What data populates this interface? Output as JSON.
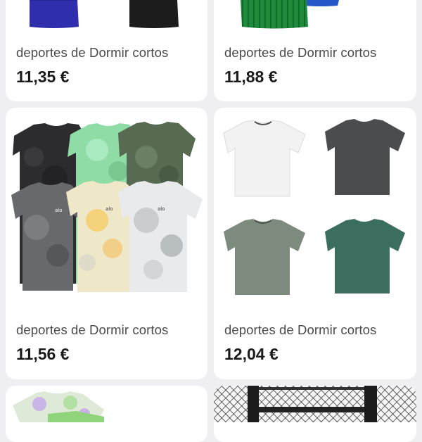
{
  "products": [
    {
      "title": "deportes de Dormir cortos",
      "price": "11,35 €"
    },
    {
      "title": "deportes de Dormir cortos",
      "price": "11,88 €"
    },
    {
      "title": "deportes de Dormir cortos",
      "price": "11,56 €"
    },
    {
      "title": "deportes de Dormir cortos",
      "price": "12,04 €"
    }
  ],
  "brand_logo": "alo",
  "colors": {
    "background": "#efeff1",
    "card": "#ffffff",
    "price": "#1a1a1a",
    "title": "#4a4a4a"
  }
}
